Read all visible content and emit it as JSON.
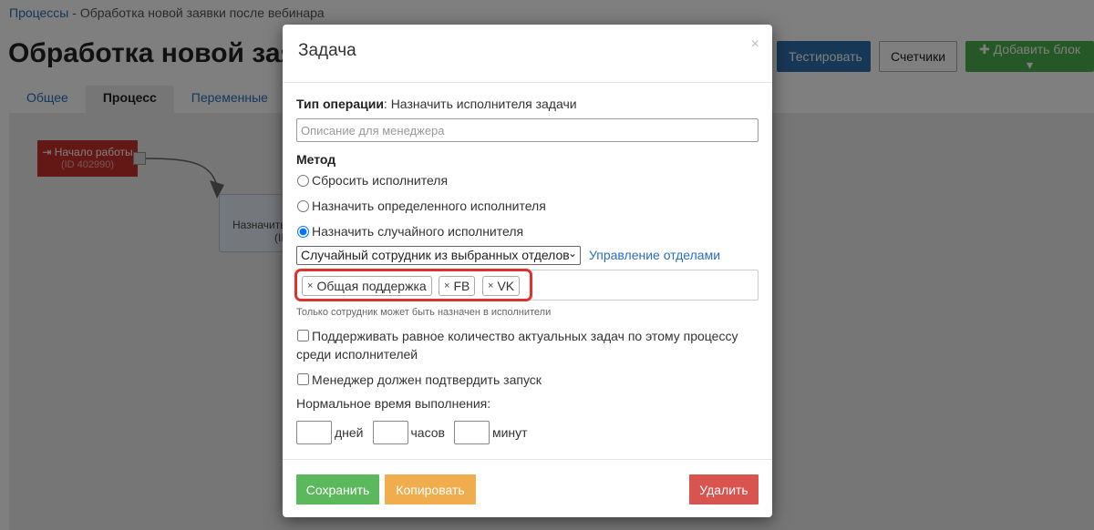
{
  "breadcrumb": {
    "link": "Процессы",
    "separator": " - ",
    "current": "Обработка новой заявки после вебинара"
  },
  "page_title": "Обработка новой заявки после вебинара",
  "tabs": [
    {
      "label": "Общее"
    },
    {
      "label": "Процесс"
    },
    {
      "label": "Переменные"
    }
  ],
  "toolbar": {
    "test_label": "Тестировать",
    "counters_label": "Счетчики",
    "add_block_label": "✚ Добавить блок ▾"
  },
  "process_canvas": {
    "start_node": {
      "label": "⇥ Начало работы",
      "sub": "(ID 402990)"
    },
    "task_node": {
      "line1": "Назначить",
      "line2": "(ID"
    }
  },
  "modal": {
    "title": "Задача",
    "close": "×",
    "operation_type_label": "Тип операции",
    "operation_type_value": ": Назначить исполнителя задачи",
    "description_placeholder": "Описание для менеджера",
    "method_label": "Метод",
    "method_options": [
      {
        "label": "Сбросить исполнителя",
        "checked": false
      },
      {
        "label": "Назначить определенного исполнителя",
        "checked": false
      },
      {
        "label": "Назначить случайного исполнителя",
        "checked": true
      }
    ],
    "random_mode_select": "Случайный сотрудник из выбранных отделов",
    "manage_departments_link": "Управление отделами",
    "departments": [
      "Общая поддержка",
      "FB",
      "VK"
    ],
    "tag_remove_symbol": "×",
    "departments_hint": "Только сотрудник может быть назначен в исполнители",
    "balance_tasks_label": "Поддерживать равное количество актуальных задач по этому процессу среди исполнителей",
    "balance_tasks_checked": false,
    "manager_confirm_label": "Менеджер должен подтвердить запуск",
    "manager_confirm_checked": false,
    "normal_time_label": "Нормальное время выполнения:",
    "time_units": {
      "days": "дней",
      "hours": "часов",
      "minutes": "минут"
    },
    "buttons": {
      "save": "Сохранить",
      "copy": "Копировать",
      "delete": "Удалить"
    }
  },
  "colors": {
    "save": "#5cb85c",
    "copy": "#f0ad4e",
    "delete": "#d9534f",
    "highlight": "#e0322c",
    "primary": "#2f6fad",
    "add_block": "#4cae4c"
  }
}
